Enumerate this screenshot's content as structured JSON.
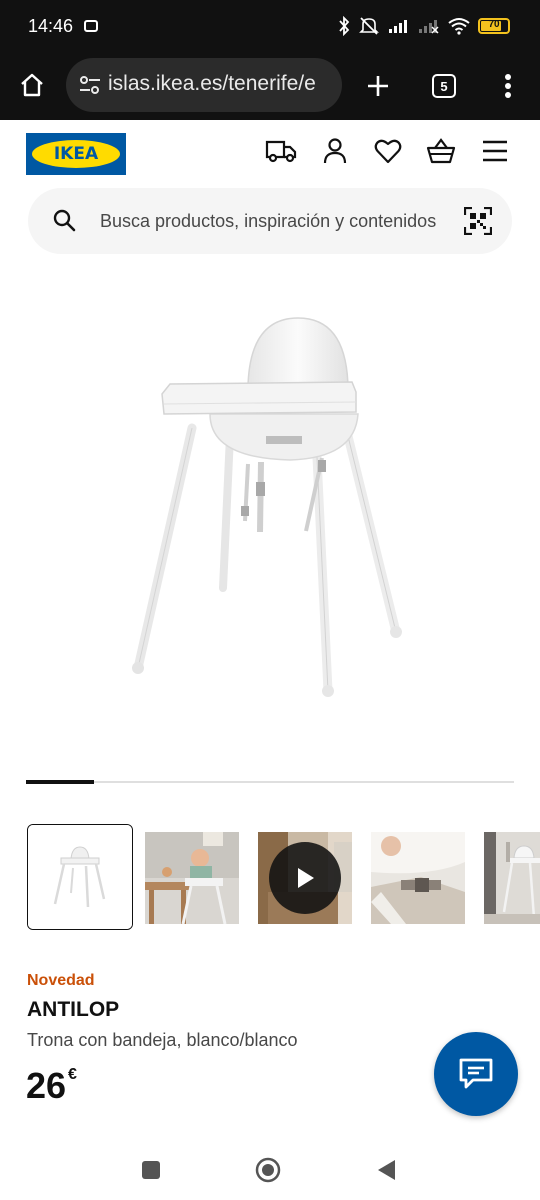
{
  "status_bar": {
    "time": "14:46",
    "battery_level": "70"
  },
  "browser": {
    "url": "islas.ikea.es/tenerife/e",
    "tab_count": "5"
  },
  "header": {
    "logo_text": "IKEA",
    "brand_blue": "#0058a3",
    "brand_yellow": "#ffdb00",
    "icons": [
      "truck-icon",
      "user-icon",
      "heart-icon",
      "basket-icon",
      "menu-icon"
    ]
  },
  "search": {
    "placeholder": "Busca productos, inspiración y contenidos"
  },
  "gallery": {
    "progress_fraction": 0.14,
    "thumbnails": [
      "highchair-white",
      "child-in-highchair",
      "video",
      "harness-closeup",
      "highchair-in-room"
    ]
  },
  "product": {
    "badge": "Novedad",
    "name": "ANTILOP",
    "description": "Trona con bandeja, blanco/blanco",
    "price": "26",
    "currency": "€"
  }
}
